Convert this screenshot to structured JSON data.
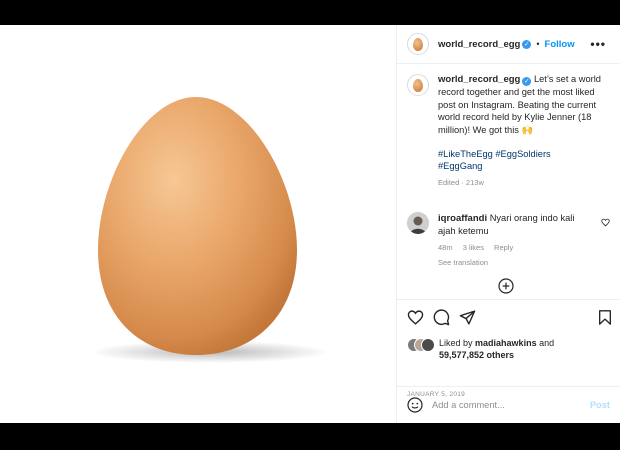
{
  "post": {
    "username": "world_record_egg",
    "verified_mark": "✓",
    "dot": "•",
    "follow_label": "Follow",
    "more_label": "•••",
    "image_alt": "brown-egg-photo"
  },
  "caption": {
    "username": "world_record_egg",
    "text": "Let’s set a world record together and get the most liked post on Instagram. Beating the current world record held by Kylie Jenner (18 million)! We got this 🙌",
    "hashtags": [
      "#LikeTheEgg",
      "#EggSoldiers",
      "#EggGang"
    ],
    "edited": "Edited · 213w"
  },
  "comment": {
    "username": "iqroaffandi",
    "text": "Nyari orang indo kali ajah ketemu",
    "time": "48m",
    "likes": "3 likes",
    "reply_label": "Reply",
    "see_translation": "See translation"
  },
  "actions": {
    "icons": [
      "heart-icon",
      "comment-icon",
      "share-icon",
      "bookmark-icon"
    ],
    "liked_by_prefix": "Liked by",
    "liked_by_user": "madiahawkins",
    "and": "and",
    "others_count": "59,577,852 others",
    "date": "JANUARY 5, 2019"
  },
  "add_comment": {
    "placeholder": "Add a comment...",
    "post_label": "Post"
  },
  "colors": {
    "accent": "#0095f6",
    "link": "#00376b",
    "muted": "#8e8e8e",
    "egg": "#e8a468"
  }
}
